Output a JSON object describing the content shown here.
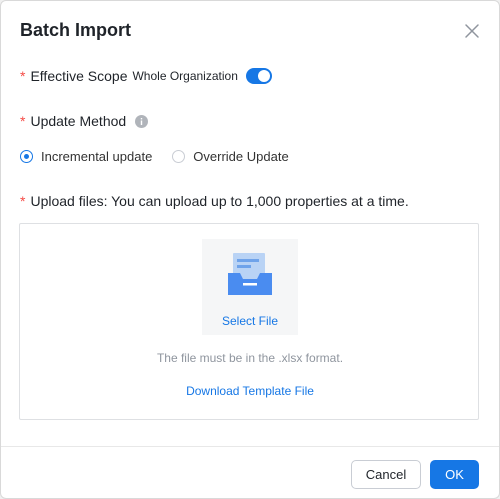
{
  "dialog": {
    "title": "Batch Import",
    "close_icon": "close-icon"
  },
  "scope": {
    "required_mark": "*",
    "label": "Effective Scope",
    "value": "Whole Organization",
    "toggle_on": true
  },
  "method": {
    "required_mark": "*",
    "label": "Update Method",
    "info_icon": "info-icon",
    "options": [
      {
        "label": "Incremental update",
        "selected": true
      },
      {
        "label": "Override Update",
        "selected": false
      }
    ]
  },
  "upload": {
    "required_mark": "*",
    "label": "Upload files: You can upload up to 1,000 properties at a time.",
    "select_file": "Select File",
    "hint": "The file must be in the .xlsx format.",
    "download_template": "Download Template File",
    "file_icon": "file-tray-icon"
  },
  "footer": {
    "cancel": "Cancel",
    "ok": "OK"
  },
  "colors": {
    "accent": "#1677e5",
    "required": "#f54a45",
    "muted": "#8f959e"
  }
}
